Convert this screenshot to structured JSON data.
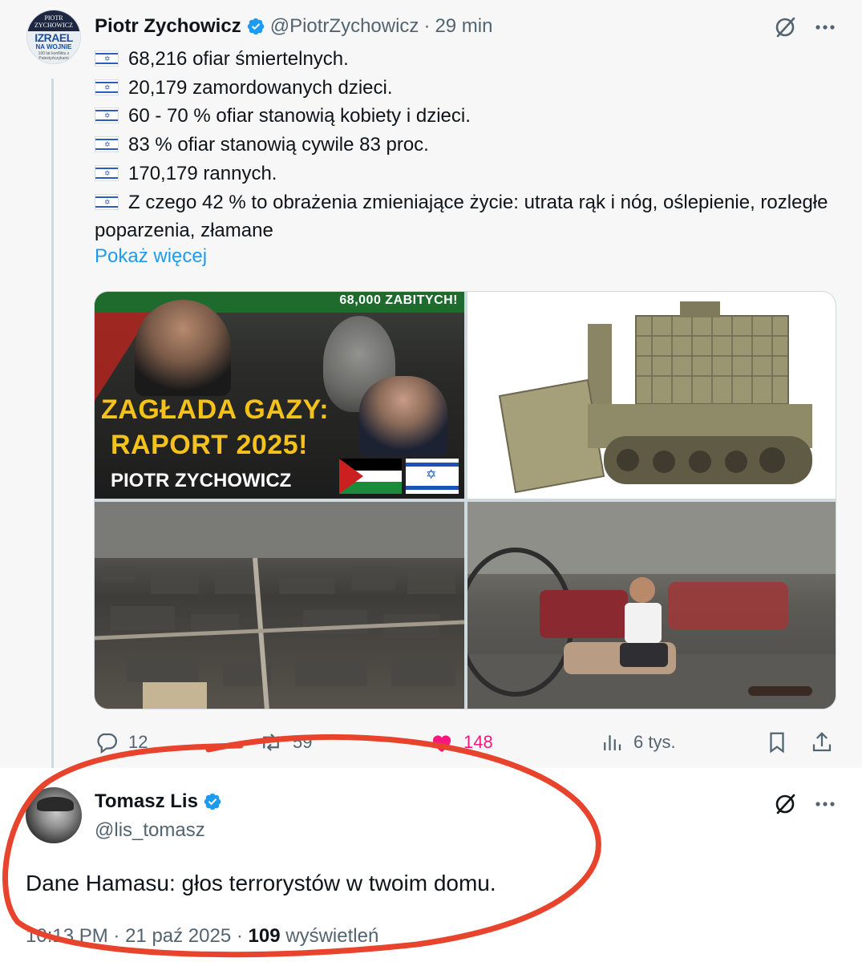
{
  "parent_tweet": {
    "author_name": "Piotr Zychowicz",
    "author_handle": "@PiotrZychowicz",
    "separator": "·",
    "time": "29 min",
    "avatar": {
      "top_text": "PIOTR ZYCHOWICZ",
      "main_text": "IZRAEL",
      "sub_text": "NA WOJNIE",
      "tiny_text": "100 lat konfliktu z Palestyńczykami"
    },
    "lines": [
      "68,216 ofiar śmiertelnych.",
      "20,179 zamordowanych dzieci.",
      "60 - 70 % ofiar stanowią kobiety i dzieci.",
      "83 % ofiar stanowią cywile 83 proc.",
      "170,179 rannych.",
      "Z czego 42 % to obrażenia zmieniające życie: utrata rąk i nóg, oślepienie, rozległe poparzenia, złamane"
    ],
    "show_more": "Pokaż więcej",
    "media": {
      "thumb1": {
        "banner": "68,000 ZABITYCH!",
        "title_line1": "ZAGŁADA GAZY:",
        "title_line2": "RAPORT 2025!",
        "name": "PIOTR ZYCHOWICZ"
      },
      "thumb2": "armored bulldozer",
      "thumb3": "aerial view of destroyed city",
      "thumb4": "child sitting on the ground"
    },
    "actions": {
      "replies": "12",
      "reposts": "59",
      "likes": "148",
      "views": "6 tys."
    }
  },
  "quoted_tweet": {
    "author_name": "Tomasz Lis",
    "author_handle": "@lis_tomasz",
    "text": "Dane Hamasu: głos terrorystów w twoim domu.",
    "time": "10:13 PM",
    "separator1": "·",
    "date": "21 paź 2025",
    "separator2": "·",
    "views_count": "109",
    "views_label": "wyświetleń"
  },
  "colors": {
    "accent": "#1d9bf0",
    "like": "#f91880",
    "secondary_text": "#536471",
    "annotation": "#e8432c"
  },
  "icons": [
    "verified-badge-icon",
    "grok-icon",
    "more-icon",
    "reply-icon",
    "repost-icon",
    "like-icon",
    "views-icon",
    "bookmark-icon",
    "share-icon",
    "israel-flag-icon"
  ]
}
